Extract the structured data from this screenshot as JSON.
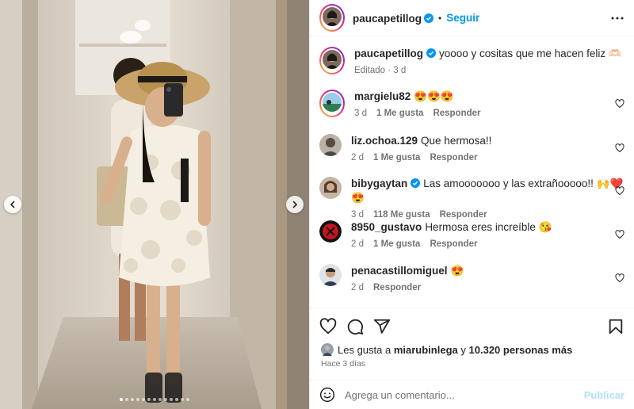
{
  "post": {
    "author": "paucapetillog",
    "follow_label": "Seguir",
    "separator": "•",
    "caption": "yoooo y cositas que me hacen feliz 🫶🏻",
    "caption_meta": "Editado · 3 d"
  },
  "carousel": {
    "slide_count": 13,
    "active_index": 0
  },
  "comments": [
    {
      "user": "margielu82",
      "text": "😍😍😍",
      "time": "3 d",
      "likes": "1 Me gusta",
      "reply": "Responder"
    },
    {
      "user": "liz.ochoa.129",
      "text": "Que hermosa!!",
      "time": "2 d",
      "likes": "1 Me gusta",
      "reply": "Responder"
    },
    {
      "user": "bibygaytan",
      "text": "Las amooooooo y las extrañooooo!! 🙌❤️😍",
      "time": "3 d",
      "likes": "118 Me gusta",
      "reply": "Responder"
    },
    {
      "user": "8950_gustavo",
      "text": "Hermosa eres increíble 😘",
      "time": "2 d",
      "likes": "1 Me gusta",
      "reply": "Responder"
    },
    {
      "user": "penacastillomiguel",
      "text": "😍",
      "time": "2 d",
      "likes": "",
      "reply": "Responder"
    }
  ],
  "likes": {
    "prefix": "Les gusta a",
    "user": "miarubinlega",
    "middle": "y",
    "others": "10.320 personas más"
  },
  "posted": "Hace 3 días",
  "composer": {
    "placeholder": "Agrega un comentario...",
    "submit_label": "Publicar"
  },
  "colors": {
    "accent": "#0095f6",
    "verified": "#0095f6",
    "publish_disabled": "#b2dffc"
  }
}
